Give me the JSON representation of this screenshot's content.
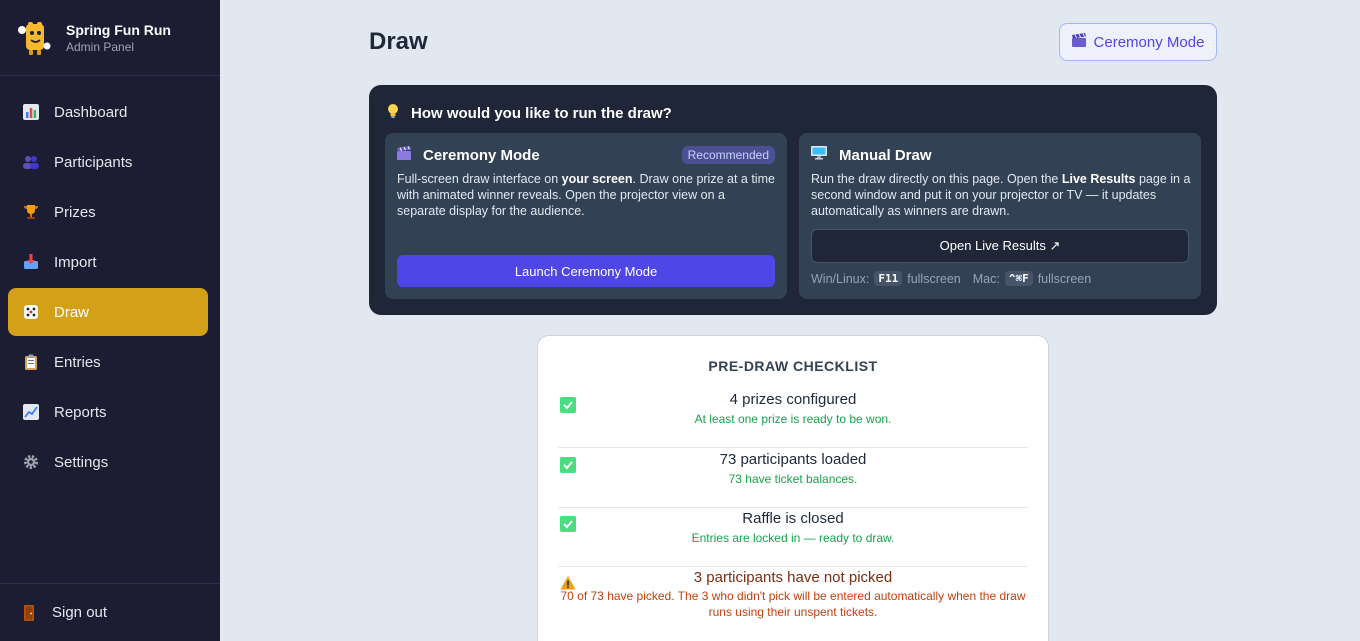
{
  "brand": {
    "title": "Spring Fun Run",
    "subtitle": "Admin Panel"
  },
  "nav": {
    "items": [
      {
        "label": "Dashboard",
        "icon": "bar-chart-icon"
      },
      {
        "label": "Participants",
        "icon": "people-icon"
      },
      {
        "label": "Prizes",
        "icon": "trophy-icon"
      },
      {
        "label": "Import",
        "icon": "inbox-icon"
      },
      {
        "label": "Draw",
        "icon": "dice-icon",
        "active": true
      },
      {
        "label": "Entries",
        "icon": "clipboard-icon"
      },
      {
        "label": "Reports",
        "icon": "trend-chart-icon"
      },
      {
        "label": "Settings",
        "icon": "gear-icon"
      }
    ],
    "signout": "Sign out"
  },
  "page": {
    "title": "Draw",
    "ceremony_button": "Ceremony Mode"
  },
  "panel": {
    "heading": "How would you like to run the draw?",
    "ceremony": {
      "title": "Ceremony Mode",
      "badge": "Recommended",
      "desc_1": "Full-screen draw interface on ",
      "desc_bold": "your screen",
      "desc_2": ". Draw one prize at a time with animated winner reveals. Open the projector view on a separate display for the audience.",
      "button": "Launch Ceremony Mode"
    },
    "manual": {
      "title": "Manual Draw",
      "desc_1": "Run the draw directly on this page. Open the ",
      "desc_bold": "Live Results",
      "desc_2": " page in a second window and put it on your projector or TV — it updates automatically as winners are drawn.",
      "button": "Open Live Results ↗",
      "hint_win_label": "Win/Linux:",
      "hint_win_key": "F11",
      "hint_win_suffix": "fullscreen",
      "hint_mac_label": "Mac:",
      "hint_mac_key": "^⌘F",
      "hint_mac_suffix": "fullscreen"
    }
  },
  "checklist": {
    "title": "PRE-DRAW CHECKLIST",
    "items": [
      {
        "status": "ok",
        "title": "4 prizes configured",
        "detail": "At least one prize is ready to be won."
      },
      {
        "status": "ok",
        "title": "73 participants loaded",
        "detail": "73 have ticket balances."
      },
      {
        "status": "ok",
        "title": "Raffle is closed",
        "detail": "Entries are locked in — ready to draw."
      },
      {
        "status": "warn",
        "title": "3 participants have not picked",
        "detail": "70 of 73 have picked. The 3 who didn't pick will be entered automatically when the draw runs using their unspent tickets."
      }
    ]
  },
  "colors": {
    "sidebar_bg": "#1c1d33",
    "active_nav": "#d4a017",
    "accent": "#4f46e5",
    "panel_bg": "#1e2638",
    "success": "#16a34a",
    "warning": "#c2410c"
  }
}
